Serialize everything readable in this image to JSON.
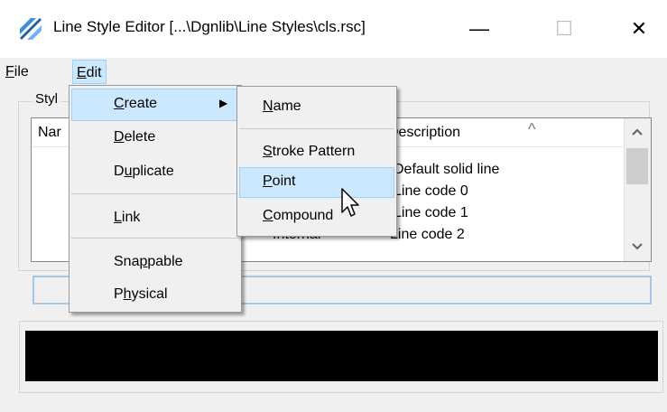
{
  "window": {
    "title": "Line Style Editor [...\\Dgnlib\\Line Styles\\cls.rsc]",
    "minimize_glyph": "—",
    "maximize_glyph": "☐",
    "close_glyph": "✕",
    "app_icon": "line-style-editor-icon"
  },
  "menubar": {
    "file": "File",
    "edit": "Edit"
  },
  "group": {
    "label": "Styl"
  },
  "list": {
    "columns": {
      "name": "Nar",
      "description": "Description"
    },
    "sort_indicator": "^",
    "rows": [
      {
        "type": "",
        "description": "Default solid line"
      },
      {
        "type": "",
        "description": "Line code 0"
      },
      {
        "type": "",
        "description": "Line code 1"
      },
      {
        "type": "Internal",
        "description": "Line code 2"
      }
    ]
  },
  "edit_menu": {
    "create": "Create",
    "delete": "Delete",
    "duplicate": "Duplicate",
    "link": "Link",
    "snappable": "Snappable",
    "physical": "Physical"
  },
  "create_submenu": {
    "name": "Name",
    "stroke_pattern": "Stroke Pattern",
    "point": "Point",
    "compound": "Compound"
  },
  "colors": {
    "highlight": "#cce8ff",
    "highlight_border": "#99d1ff",
    "preview_bg": "#000000"
  }
}
